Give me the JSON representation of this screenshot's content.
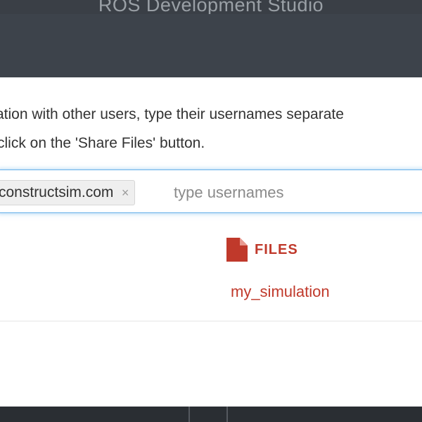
{
  "app": {
    "title": "ROS Development Studio"
  },
  "share_dialog": {
    "instructions_line1": "ation with other users, type their usernames separate",
    "instructions_line2": "click on the 'Share Files' button.",
    "tag": {
      "label": "constructsim.com",
      "remove_symbol": "×"
    },
    "input": {
      "placeholder": "type usernames",
      "value": ""
    },
    "files": {
      "header": "FILES",
      "icon": "file-icon",
      "items": [
        "my_simulation"
      ]
    }
  },
  "colors": {
    "accent": "#c0392b",
    "focus_border": "#66afe9",
    "header_bg": "#3d434b"
  }
}
